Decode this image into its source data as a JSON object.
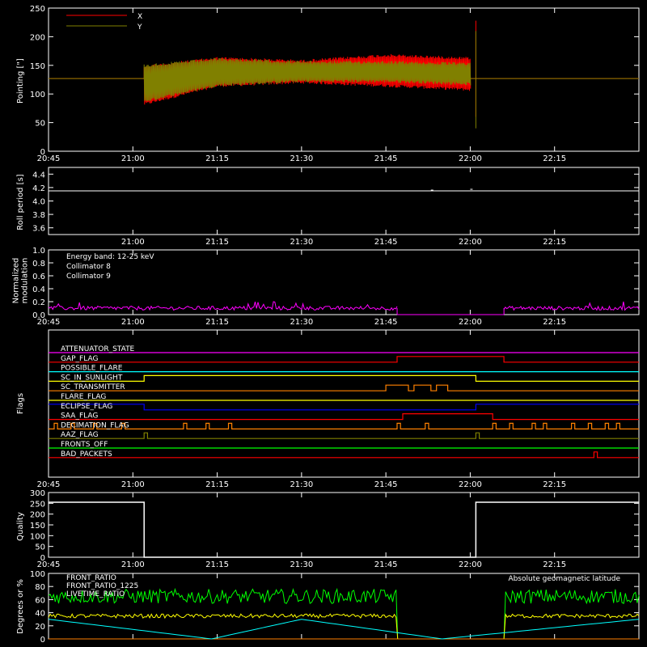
{
  "chart_data": [
    {
      "type": "line",
      "ylabel": "Pointing [\"]",
      "ylim": [
        0,
        250
      ],
      "yticks": [
        0,
        50,
        100,
        150,
        200,
        250
      ],
      "xticks": [
        "20:45",
        "21:00",
        "21:15",
        "21:30",
        "21:45",
        "22:00",
        "22:15"
      ],
      "xlim": [
        "20:45",
        "22:30"
      ],
      "grid": false,
      "legend_position": "top-left",
      "series": [
        {
          "name": "X",
          "color": "#ff0000",
          "envelope": {
            "time": [
              "21:02",
              "21:15",
              "21:30",
              "21:45",
              "22:00"
            ],
            "upper": [
              150,
              165,
              160,
              170,
              165
            ],
            "lower": [
              80,
              112,
              118,
              112,
              105
            ]
          },
          "baseline": 127
        },
        {
          "name": "Y",
          "color": "#808000",
          "envelope": {
            "time": [
              "21:02",
              "21:15",
              "21:30",
              "21:45",
              "22:00"
            ],
            "upper": [
              152,
              163,
              158,
              158,
              155
            ],
            "lower": [
              85,
              113,
              120,
              120,
              115
            ]
          },
          "baseline": 127
        }
      ]
    },
    {
      "type": "line",
      "ylabel": "Roll period [s]",
      "ylim": [
        3.5,
        4.5
      ],
      "yticks": [
        "3.6",
        "3.8",
        "4.0",
        "4.2",
        "4.4"
      ],
      "xticks": [
        "21:00",
        "21:15",
        "21:30",
        "21:45",
        "22:00",
        "22:15"
      ],
      "series": [
        {
          "color": "#ffffff",
          "values": [
            4.15
          ]
        }
      ]
    },
    {
      "type": "line",
      "ylabel": "Normalized\nmodulation",
      "ylim": [
        0,
        1
      ],
      "yticks": [
        "0.0",
        "0.2",
        "0.4",
        "0.6",
        "0.8",
        "1.0"
      ],
      "xticks": [
        "20:45",
        "21:00",
        "21:15",
        "21:30",
        "21:45",
        "22:00",
        "22:15"
      ],
      "annotation": "Energy band: 12-25 keV",
      "series": [
        {
          "name": "Collimator 8",
          "color": "#00ffff"
        },
        {
          "name": "Collimator 9",
          "color": "#ff00ff",
          "mean": 0.1,
          "segments": [
            [
              "20:45",
              "21:47"
            ],
            [
              "22:06",
              "22:30"
            ]
          ]
        }
      ]
    },
    {
      "type": "line",
      "ylabel": "Flags",
      "xticks": [
        "20:45",
        "21:00",
        "21:15",
        "21:30",
        "21:45",
        "22:00",
        "22:15"
      ],
      "flags": [
        {
          "name": "ATTENUATOR_STATE",
          "color": "#ff00ff",
          "high": []
        },
        {
          "name": "GAP_FLAG",
          "color": "#ff0000",
          "high": [
            [
              "21:47",
              "22:06"
            ]
          ]
        },
        {
          "name": "POSSIBLE_FLARE",
          "color": "#00ffff",
          "high": []
        },
        {
          "name": "SC_IN_SUNLIGHT",
          "color": "#ffff00",
          "high": [
            [
              "21:02",
              "22:01"
            ]
          ]
        },
        {
          "name": "SC_TRANSMITTER",
          "color": "#ff8000",
          "high": [
            [
              "21:45",
              "21:49"
            ],
            [
              "21:50",
              "21:53"
            ],
            [
              "21:54",
              "21:56"
            ]
          ]
        },
        {
          "name": "FLARE_FLAG",
          "color": "#ffff00",
          "high": []
        },
        {
          "name": "ECLIPSE_FLAG",
          "color": "#0000ff",
          "high": [
            [
              "20:45",
              "21:02"
            ],
            [
              "22:01",
              "22:30"
            ]
          ]
        },
        {
          "name": "SAA_FLAG",
          "color": "#ff0000",
          "high": [
            [
              "21:48",
              "22:04"
            ]
          ]
        },
        {
          "name": "DECIMATION_FLAG",
          "color": "#ff8000",
          "pulses": [
            "20:46",
            "20:49",
            "20:53",
            "20:58",
            "21:09",
            "21:13",
            "21:17",
            "21:47",
            "21:52",
            "22:04",
            "22:07",
            "22:11",
            "22:13",
            "22:18",
            "22:21",
            "22:24",
            "22:26"
          ]
        },
        {
          "name": "AAZ_FLAG",
          "color": "#808000",
          "pulses": [
            "21:02",
            "22:01"
          ]
        },
        {
          "name": "FRONTS_OFF",
          "color": "#00ff00",
          "high": []
        },
        {
          "name": "BAD_PACKETS",
          "color": "#ff0000",
          "pulses": [
            "22:22"
          ]
        }
      ]
    },
    {
      "type": "line",
      "ylabel": "Quality",
      "ylim": [
        0,
        300
      ],
      "yticks": [
        0,
        50,
        100,
        150,
        200,
        250,
        300
      ],
      "xticks": [
        "20:45",
        "21:00",
        "21:15",
        "21:30",
        "21:45",
        "22:00",
        "22:15"
      ],
      "series": [
        {
          "color": "#ffffff",
          "steps": [
            [
              "20:45",
              255
            ],
            [
              "21:02",
              0
            ],
            [
              "22:01",
              255
            ],
            [
              "22:30",
              255
            ]
          ]
        }
      ]
    },
    {
      "type": "line",
      "ylabel": "Degrees or %",
      "ylim": [
        0,
        100
      ],
      "yticks": [
        0,
        20,
        40,
        60,
        80,
        100
      ],
      "xticks": [
        "20:45",
        "21:00",
        "21:15",
        "21:30",
        "21:45",
        "22:00",
        "22:15"
      ],
      "series": [
        {
          "name": "FRONT_RATIO",
          "color": "#ffff00",
          "mean": 35
        },
        {
          "name": "FRONT_RATIO_1225",
          "color": "#00ff00",
          "mean": 65
        },
        {
          "name": "LIVETIME_RATIO",
          "color": "#ff8000",
          "mean": 0
        },
        {
          "name": "Absolute geomagnetic latitude",
          "color": "#00ffff",
          "time": [
            "20:45",
            "21:14",
            "21:30",
            "21:55",
            "22:30"
          ],
          "values": [
            30,
            0,
            30,
            0,
            30
          ]
        }
      ]
    }
  ]
}
